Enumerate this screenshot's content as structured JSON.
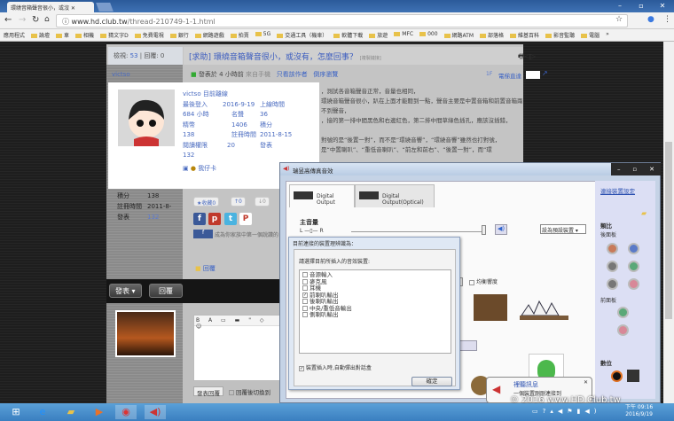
{
  "browser": {
    "tab_title": "環繞音箱聲音很小，或沒",
    "url_host": "www.hd.club.tw",
    "url_path": "/thread-210749-1-1.html",
    "bookmarks": [
      "應用程式",
      "論壇",
      "車",
      "相機",
      "猜文字D",
      "免費電視",
      "銀行",
      "網路遊戲",
      "拍賣",
      "5G",
      "交通工具（機車）",
      "軟體下載",
      "旅遊",
      "MFC",
      "000",
      "網路ATM",
      "部落格",
      "維基百科",
      "影音監聽",
      "電腦"
    ],
    "more": "»"
  },
  "thread": {
    "views_label": "檢視:",
    "views": "53",
    "replies_label": "回覆:",
    "replies": "0",
    "title": "[求助] 環繞音箱聲音很小，或沒有，怎麼回事？",
    "copy_link": "[複製鏈接]",
    "posted": "發表於 4 小時前",
    "from": "來自手機",
    "only_author": "只看該作者",
    "reverse": "倒序瀏覽",
    "floor": "1F",
    "jump": "電梯直達"
  },
  "user": {
    "name": "victso",
    "card_title": "victso 目前離線",
    "rows": [
      [
        "最後登入",
        "2016-9-19",
        "上線時間"
      ],
      [
        "684 小時",
        "名聲",
        "36"
      ],
      [
        "精幣",
        "1406",
        "積分"
      ],
      [
        "138",
        "註冊時間",
        "2011-8-15"
      ],
      [
        "閱讀權限",
        "20",
        "發表"
      ],
      [
        "132",
        "",
        ""
      ]
    ],
    "card_link": "我仔卡",
    "side_stats": [
      [
        "積分",
        "138"
      ],
      [
        "註冊時間",
        "2011-8-"
      ],
      [
        "發表",
        "132"
      ]
    ]
  },
  "post_lines": [
    "，測試各音箱聲音正常，音量也相同，",
    "環繞音箱聲音很小，趴在上面才能聽到一點，聲音主要是中置音箱和前置音箱兩",
    "不到聲音，",
    "，接的第一排中間黑色和右邊紅色，第二排中間草綠色插孔，應該沒插錯，",
    "",
    "對號的是“後置一對”，而不是“環繞音響”，“環繞音響”雖然也打對號，",
    "是“中置喇叭”、“重低音喇叭”、“前左和前右”、“後置一對”，而“環"
  ],
  "actions": {
    "fav": "收藏0",
    "up": "0",
    "down": "0",
    "fb_text": "成為你家族中第一個說讚的",
    "reply": "回覆",
    "post_btn": "發表 ▾",
    "reply_btn": "回覆",
    "submit": "發表回覆",
    "after": "回覆後切換到"
  },
  "sound": {
    "title": "瑞昱高傳真音效",
    "tab1": "Digital Output",
    "tab2": "Digital Output(Optical)",
    "main_volume": "主音量",
    "L": "L",
    "R": "R",
    "default_device": "設為預設裝置",
    "reset": "重設",
    "loudness": "均衡響度",
    "panel": {
      "link": "連接裝置設定",
      "analog": "類比",
      "back": "後面板",
      "front": "前面板",
      "digital": "數位"
    }
  },
  "inner": {
    "title": "目前連接的裝置理辨識為：",
    "prompt": "請選擇目前所插入的音效裝置:",
    "items": [
      {
        "label": "音源輸入",
        "checked": false
      },
      {
        "label": "麥克風",
        "checked": false
      },
      {
        "label": "耳機",
        "checked": false
      },
      {
        "label": "前喇叭輸出",
        "checked": true
      },
      {
        "label": "後喇叭輸出",
        "checked": false
      },
      {
        "label": "中央/重低音輸出",
        "checked": false
      },
      {
        "label": "側喇叭輸出",
        "checked": false
      }
    ],
    "auto_popup": "裝置插入時,自動彈出對話盒",
    "ok": "確定"
  },
  "balloon": {
    "title": "裡聽訊息",
    "text": "一個裝置剛剛連接到"
  },
  "watermark": "© 2016 www.HD.Club.tw",
  "clock": {
    "time": "下午 09:16",
    "date": "2016/9/19"
  }
}
